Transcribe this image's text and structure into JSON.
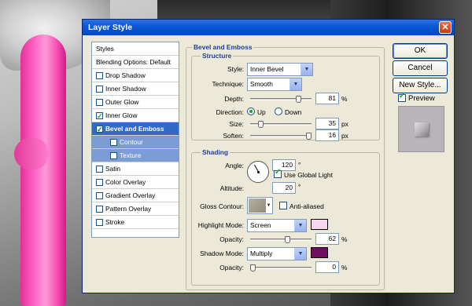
{
  "window": {
    "title": "Layer Style",
    "close_glyph": "✕"
  },
  "styles_list": {
    "items": [
      {
        "label": "Styles",
        "checkbox": false,
        "checked": false
      },
      {
        "label": "Blending Options: Default",
        "checkbox": false,
        "checked": false
      },
      {
        "label": "Drop Shadow",
        "checkbox": true,
        "checked": false
      },
      {
        "label": "Inner Shadow",
        "checkbox": true,
        "checked": false
      },
      {
        "label": "Outer Glow",
        "checkbox": true,
        "checked": false
      },
      {
        "label": "Inner Glow",
        "checkbox": true,
        "checked": true
      },
      {
        "label": "Bevel and Emboss",
        "checkbox": true,
        "checked": true,
        "selected": true
      },
      {
        "label": "Contour",
        "checkbox": true,
        "checked": false,
        "sub": true
      },
      {
        "label": "Texture",
        "checkbox": true,
        "checked": false,
        "sub": true
      },
      {
        "label": "Satin",
        "checkbox": true,
        "checked": false
      },
      {
        "label": "Color Overlay",
        "checkbox": true,
        "checked": false
      },
      {
        "label": "Gradient Overlay",
        "checkbox": true,
        "checked": false
      },
      {
        "label": "Pattern Overlay",
        "checkbox": true,
        "checked": false
      },
      {
        "label": "Stroke",
        "checkbox": true,
        "checked": false
      }
    ]
  },
  "bevel": {
    "group_title": "Bevel and Emboss",
    "structure": {
      "title": "Structure",
      "style_label": "Style:",
      "style_value": "Inner Bevel",
      "technique_label": "Technique:",
      "technique_value": "Smooth",
      "depth_label": "Depth:",
      "depth_value": "81",
      "depth_unit": "%",
      "depth_fraction": 0.81,
      "direction_label": "Direction:",
      "direction_up": "Up",
      "direction_down": "Down",
      "size_label": "Size:",
      "size_value": "35",
      "size_unit": "px",
      "size_fraction": 0.14,
      "soften_label": "Soften:",
      "soften_value": "16",
      "soften_unit": "px",
      "soften_fraction": 1.0
    },
    "shading": {
      "title": "Shading",
      "angle_label": "Angle:",
      "angle_value": "120",
      "angle_unit": "°",
      "global_light_label": "Use Global Light",
      "altitude_label": "Altitude:",
      "altitude_value": "20",
      "altitude_unit": "°",
      "gloss_label": "Gloss Contour:",
      "anti_aliased_label": "Anti-aliased",
      "highlight_mode_label": "Highlight Mode:",
      "highlight_mode_value": "Screen",
      "highlight_color": "#f6d7ee",
      "highlight_opacity_label": "Opacity:",
      "highlight_opacity_value": "62",
      "highlight_opacity_unit": "%",
      "highlight_opacity_fraction": 0.62,
      "shadow_mode_label": "Shadow Mode:",
      "shadow_mode_value": "Multiply",
      "shadow_color": "#6e0f5f",
      "shadow_opacity_label": "Opacity:",
      "shadow_opacity_value": "0",
      "shadow_opacity_unit": "%",
      "shadow_opacity_fraction": 0.0
    }
  },
  "buttons": {
    "ok": "OK",
    "cancel": "Cancel",
    "new_style": "New Style..."
  },
  "preview": {
    "label": "Preview",
    "checked": true
  }
}
